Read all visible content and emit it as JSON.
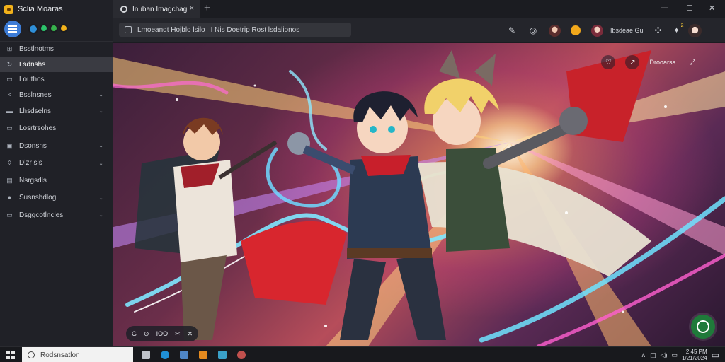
{
  "app": {
    "title": "Sclia Moaras",
    "logo_icon": "app-logo-icon"
  },
  "sidebar": {
    "avatars": [
      {
        "color": "#2f8fd8"
      },
      {
        "color": "#2cc36b"
      },
      {
        "color": "#37b24d"
      },
      {
        "color": "#f2b21b"
      }
    ],
    "items": [
      {
        "label": "Bsstlnotms",
        "icon": "grid-icon",
        "glyph": "⊞",
        "chevron": false,
        "active": false
      },
      {
        "label": "Lsdnshs",
        "icon": "refresh-icon",
        "glyph": "↻",
        "chevron": false,
        "active": true
      },
      {
        "label": "Louthos",
        "icon": "bookmark-icon",
        "glyph": "▭",
        "chevron": false,
        "active": false
      },
      {
        "label": "Bsslnsnes",
        "icon": "share-icon",
        "glyph": "<",
        "chevron": true,
        "active": false
      },
      {
        "label": "Lhsdselns",
        "icon": "folder-icon",
        "glyph": "▬",
        "chevron": true,
        "active": false
      },
      {
        "label": "Losrtrsohes",
        "icon": "window-icon",
        "glyph": "▭",
        "chevron": false,
        "active": false
      },
      {
        "label": "Dsonsns",
        "icon": "shield-icon",
        "glyph": "▣",
        "chevron": true,
        "active": false
      },
      {
        "label": "Dlzr sls",
        "icon": "location-icon",
        "glyph": "◊",
        "chevron": true,
        "active": false
      },
      {
        "label": "Nsrgsdls",
        "icon": "download-icon",
        "glyph": "▤",
        "chevron": false,
        "active": false
      },
      {
        "label": "Susnshdlog",
        "icon": "globe-icon",
        "glyph": "●",
        "chevron": true,
        "active": false
      },
      {
        "label": "Dsggcotlncles",
        "icon": "settings-icon",
        "glyph": "▭",
        "chevron": true,
        "active": false
      }
    ]
  },
  "browser": {
    "tab_title": "Inuban Imagchag",
    "tab_close": "×",
    "new_tab": "+",
    "window_controls": {
      "minimize": "—",
      "maximize": "☐",
      "close": "✕"
    },
    "url_primary": "Lmoeandt Hojblo lsilo",
    "url_secondary": "I Nis Doetrip Rost lsdalionos",
    "toolbar_label": "Ibsdeae Gu",
    "notification_count": "2"
  },
  "content": {
    "overlay_label": "Drooarss",
    "media_controls": [
      "G",
      "⊙",
      "IOO",
      "✂",
      "✕"
    ]
  },
  "taskbar": {
    "search_placeholder": "Rodsnsatlon",
    "apps": [
      {
        "icon": "task-view-icon",
        "color": "#bfc3ca"
      },
      {
        "icon": "edge-icon",
        "color": "#1f8fd6"
      },
      {
        "icon": "explorer-icon",
        "color": "#4f86c6"
      },
      {
        "icon": "orange-app-icon",
        "color": "#e58a1f"
      },
      {
        "icon": "store-icon",
        "color": "#3aa0c8"
      },
      {
        "icon": "record-app-icon",
        "color": "#c0504d"
      }
    ],
    "clock_time": "2:45 PM",
    "clock_date": "1/21/2024"
  }
}
